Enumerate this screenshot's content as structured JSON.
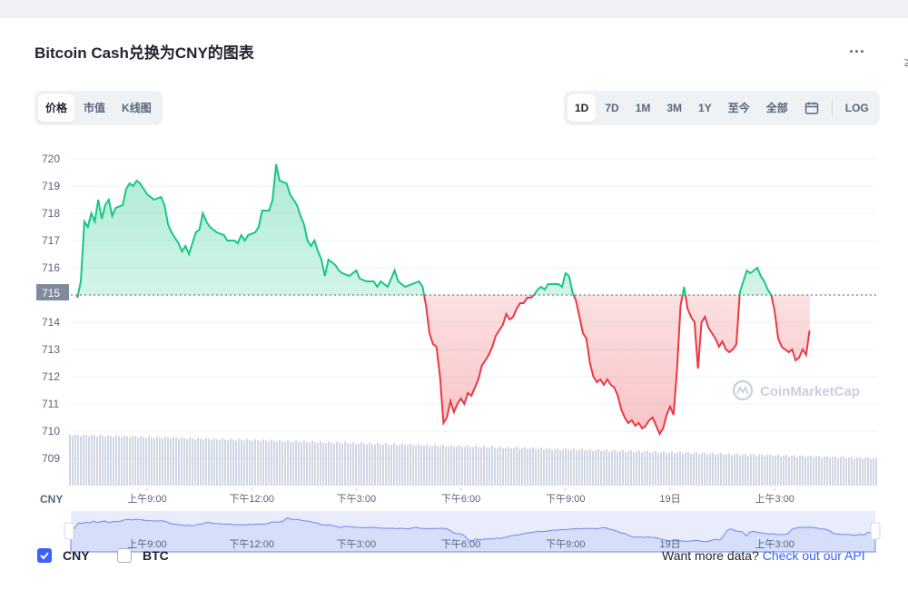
{
  "title": "Bitcoin Cash兑换为CNY的图表",
  "more_label": "...",
  "edge_glyph": "≥",
  "left_tabs": [
    {
      "label": "价格",
      "active": true
    },
    {
      "label": "市值",
      "active": false
    },
    {
      "label": "K线图",
      "active": false
    }
  ],
  "range_tabs": [
    {
      "label": "1D",
      "active": true
    },
    {
      "label": "7D",
      "active": false
    },
    {
      "label": "1M",
      "active": false
    },
    {
      "label": "3M",
      "active": false
    },
    {
      "label": "1Y",
      "active": false
    },
    {
      "label": "至今",
      "active": false
    },
    {
      "label": "全部",
      "active": false
    }
  ],
  "log_label": "LOG",
  "watermark": "CoinMarketCap",
  "currency_label": "CNY",
  "legend": {
    "cny": {
      "label": "CNY",
      "checked": true
    },
    "btc": {
      "label": "BTC",
      "checked": false
    }
  },
  "api_text": "Want more data?",
  "api_link": "Check out our API",
  "colors": {
    "up": "#16c784",
    "down": "#ea3943",
    "accent": "#3861fb",
    "grid": "#eff2f5",
    "volume": "#cfd6e4"
  },
  "chart_data": {
    "type": "area",
    "baseline": 715,
    "baseline_label": "715",
    "ylim": [
      708.5,
      720.5
    ],
    "yticks": [
      720,
      719,
      718,
      717,
      716,
      715,
      714,
      713,
      712,
      711,
      710,
      709
    ],
    "x_range_hours": [
      7.0,
      31.6
    ],
    "x_ticks": [
      {
        "label": "上午9:00",
        "t": 9
      },
      {
        "label": "下午12:00",
        "t": 12
      },
      {
        "label": "下午3:00",
        "t": 15
      },
      {
        "label": "下午6:00",
        "t": 18
      },
      {
        "label": "下午9:00",
        "t": 21
      },
      {
        "label": "19日",
        "t": 24
      },
      {
        "label": "上午3:00",
        "t": 27
      }
    ],
    "series": [
      {
        "values": [
          [
            7.0,
            714.9
          ],
          [
            7.1,
            715.5
          ],
          [
            7.2,
            717.7
          ],
          [
            7.3,
            717.5
          ],
          [
            7.4,
            718.0
          ],
          [
            7.5,
            717.7
          ],
          [
            7.6,
            718.5
          ],
          [
            7.7,
            717.8
          ],
          [
            7.8,
            718.3
          ],
          [
            7.9,
            718.5
          ],
          [
            8.0,
            717.9
          ],
          [
            8.1,
            718.2
          ],
          [
            8.3,
            718.3
          ],
          [
            8.4,
            718.9
          ],
          [
            8.5,
            719.1
          ],
          [
            8.6,
            719.0
          ],
          [
            8.7,
            719.2
          ],
          [
            8.8,
            719.1
          ],
          [
            8.9,
            718.9
          ],
          [
            9.0,
            718.7
          ],
          [
            9.2,
            718.5
          ],
          [
            9.4,
            718.6
          ],
          [
            9.5,
            718.3
          ],
          [
            9.6,
            717.6
          ],
          [
            9.7,
            717.3
          ],
          [
            9.8,
            717.1
          ],
          [
            9.9,
            716.9
          ],
          [
            10.0,
            716.6
          ],
          [
            10.1,
            716.8
          ],
          [
            10.2,
            716.5
          ],
          [
            10.3,
            716.9
          ],
          [
            10.4,
            717.3
          ],
          [
            10.5,
            717.4
          ],
          [
            10.6,
            718.0
          ],
          [
            10.7,
            717.7
          ],
          [
            10.8,
            717.5
          ],
          [
            10.9,
            717.4
          ],
          [
            11.0,
            717.3
          ],
          [
            11.2,
            717.2
          ],
          [
            11.3,
            717.0
          ],
          [
            11.5,
            717.0
          ],
          [
            11.6,
            716.9
          ],
          [
            11.7,
            717.2
          ],
          [
            11.8,
            717.0
          ],
          [
            11.9,
            717.2
          ],
          [
            12.1,
            717.3
          ],
          [
            12.2,
            717.5
          ],
          [
            12.3,
            718.1
          ],
          [
            12.5,
            718.1
          ],
          [
            12.6,
            718.5
          ],
          [
            12.7,
            719.8
          ],
          [
            12.8,
            719.2
          ],
          [
            13.0,
            719.1
          ],
          [
            13.1,
            718.7
          ],
          [
            13.2,
            718.5
          ],
          [
            13.3,
            718.3
          ],
          [
            13.4,
            717.9
          ],
          [
            13.5,
            717.6
          ],
          [
            13.6,
            717.0
          ],
          [
            13.7,
            716.8
          ],
          [
            13.8,
            717.0
          ],
          [
            13.9,
            716.6
          ],
          [
            14.0,
            716.3
          ],
          [
            14.1,
            715.7
          ],
          [
            14.2,
            716.3
          ],
          [
            14.4,
            716.1
          ],
          [
            14.5,
            715.9
          ],
          [
            14.6,
            715.8
          ],
          [
            14.8,
            715.7
          ],
          [
            15.0,
            715.9
          ],
          [
            15.1,
            715.6
          ],
          [
            15.3,
            715.5
          ],
          [
            15.5,
            715.5
          ],
          [
            15.6,
            715.3
          ],
          [
            15.7,
            715.5
          ],
          [
            15.9,
            715.3
          ],
          [
            16.0,
            715.6
          ],
          [
            16.1,
            715.9
          ],
          [
            16.2,
            715.5
          ],
          [
            16.4,
            715.3
          ],
          [
            16.6,
            715.4
          ],
          [
            16.8,
            715.5
          ],
          [
            16.9,
            715.3
          ],
          [
            17.0,
            714.6
          ],
          [
            17.1,
            713.6
          ],
          [
            17.2,
            713.2
          ],
          [
            17.3,
            713.1
          ],
          [
            17.4,
            712.0
          ],
          [
            17.5,
            710.3
          ],
          [
            17.6,
            710.5
          ],
          [
            17.7,
            711.1
          ],
          [
            17.8,
            710.7
          ],
          [
            17.9,
            711.0
          ],
          [
            18.0,
            711.2
          ],
          [
            18.1,
            711.0
          ],
          [
            18.2,
            711.4
          ],
          [
            18.3,
            711.3
          ],
          [
            18.4,
            711.6
          ],
          [
            18.5,
            711.9
          ],
          [
            18.6,
            712.4
          ],
          [
            18.7,
            712.6
          ],
          [
            18.8,
            712.8
          ],
          [
            18.9,
            713.1
          ],
          [
            19.0,
            713.5
          ],
          [
            19.1,
            713.7
          ],
          [
            19.2,
            713.9
          ],
          [
            19.3,
            714.3
          ],
          [
            19.4,
            714.1
          ],
          [
            19.5,
            714.2
          ],
          [
            19.6,
            714.5
          ],
          [
            19.7,
            714.7
          ],
          [
            19.8,
            714.7
          ],
          [
            19.9,
            714.9
          ],
          [
            20.0,
            714.9
          ],
          [
            20.1,
            715.0
          ],
          [
            20.2,
            715.2
          ],
          [
            20.3,
            715.3
          ],
          [
            20.4,
            715.2
          ],
          [
            20.5,
            715.4
          ],
          [
            20.6,
            715.4
          ],
          [
            20.8,
            715.4
          ],
          [
            20.9,
            715.3
          ],
          [
            21.0,
            715.8
          ],
          [
            21.1,
            715.7
          ],
          [
            21.2,
            715.1
          ],
          [
            21.3,
            714.8
          ],
          [
            21.4,
            714.2
          ],
          [
            21.5,
            713.6
          ],
          [
            21.6,
            713.4
          ],
          [
            21.7,
            712.5
          ],
          [
            21.8,
            712.0
          ],
          [
            21.9,
            711.8
          ],
          [
            22.0,
            711.9
          ],
          [
            22.1,
            711.7
          ],
          [
            22.2,
            711.9
          ],
          [
            22.3,
            711.7
          ],
          [
            22.4,
            711.6
          ],
          [
            22.5,
            711.3
          ],
          [
            22.6,
            710.8
          ],
          [
            22.7,
            710.5
          ],
          [
            22.8,
            710.3
          ],
          [
            22.9,
            710.4
          ],
          [
            23.0,
            710.2
          ],
          [
            23.1,
            710.3
          ],
          [
            23.2,
            710.1
          ],
          [
            23.3,
            710.2
          ],
          [
            23.4,
            710.4
          ],
          [
            23.5,
            710.5
          ],
          [
            23.6,
            710.2
          ],
          [
            23.7,
            709.9
          ],
          [
            23.8,
            710.1
          ],
          [
            23.9,
            710.6
          ],
          [
            24.0,
            710.9
          ],
          [
            24.1,
            710.6
          ],
          [
            24.2,
            712.3
          ],
          [
            24.3,
            714.6
          ],
          [
            24.4,
            715.3
          ],
          [
            24.5,
            714.5
          ],
          [
            24.6,
            714.2
          ],
          [
            24.7,
            714.0
          ],
          [
            24.8,
            712.3
          ],
          [
            24.9,
            714.0
          ],
          [
            25.0,
            714.2
          ],
          [
            25.1,
            713.8
          ],
          [
            25.2,
            713.6
          ],
          [
            25.3,
            713.4
          ],
          [
            25.4,
            713.1
          ],
          [
            25.5,
            713.3
          ],
          [
            25.6,
            713.0
          ],
          [
            25.7,
            712.9
          ],
          [
            25.8,
            713.0
          ],
          [
            25.9,
            713.2
          ],
          [
            26.0,
            715.1
          ],
          [
            26.1,
            715.5
          ],
          [
            26.2,
            715.9
          ],
          [
            26.3,
            715.8
          ],
          [
            26.4,
            715.9
          ],
          [
            26.5,
            716.0
          ],
          [
            26.6,
            715.7
          ],
          [
            26.7,
            715.5
          ],
          [
            26.8,
            715.2
          ],
          [
            26.9,
            715.0
          ],
          [
            27.0,
            714.4
          ],
          [
            27.1,
            713.4
          ],
          [
            27.2,
            713.1
          ],
          [
            27.3,
            713.0
          ],
          [
            27.4,
            712.9
          ],
          [
            27.5,
            713.0
          ],
          [
            27.6,
            712.6
          ],
          [
            27.7,
            712.7
          ],
          [
            27.8,
            713.0
          ],
          [
            27.9,
            712.8
          ],
          [
            28.0,
            713.7
          ]
        ]
      }
    ],
    "nav_ticks": [
      "上午9:00",
      "下午12:00",
      "下午3:00",
      "下午6:00",
      "下午9:00",
      "19日",
      "上午3:00"
    ]
  }
}
